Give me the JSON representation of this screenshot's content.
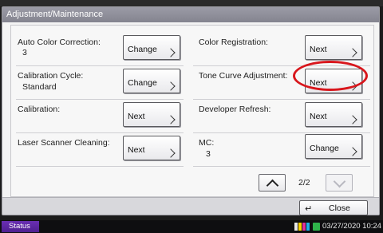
{
  "window": {
    "title": "Adjustment/Maintenance"
  },
  "items": {
    "auto_color_correction": {
      "label": "Auto Color Correction:",
      "value": "3",
      "button": "Change"
    },
    "color_registration": {
      "label": "Color Registration:",
      "button": "Next"
    },
    "calibration_cycle": {
      "label": "Calibration Cycle:",
      "value": "Standard",
      "button": "Change"
    },
    "tone_curve_adjustment": {
      "label": "Tone Curve Adjustment:",
      "button": "Next"
    },
    "calibration": {
      "label": "Calibration:",
      "button": "Next"
    },
    "developer_refresh": {
      "label": "Developer Refresh:",
      "button": "Next"
    },
    "laser_scanner_cleaning": {
      "label": "Laser Scanner Cleaning:",
      "button": "Next"
    },
    "mc": {
      "label": "MC:",
      "value": "3",
      "button": "Change"
    }
  },
  "pager": {
    "indicator": "2/2"
  },
  "footer": {
    "close_label": "Close"
  },
  "status_bar": {
    "status_label": "Status",
    "datetime": "03/27/2020 10:24"
  },
  "colors": {
    "title_bar": "#8e8e99",
    "status_button": "#5a25a0",
    "highlight": "#d8161c",
    "toner": [
      "#e8e8e8",
      "#ffd400",
      "#e0339a",
      "#1eb0e8"
    ]
  },
  "icons": {
    "chevron": "chevron-right-icon",
    "up": "chevron-up-icon",
    "down": "chevron-down-icon",
    "close": "enter-icon",
    "clock": "clock-icon"
  }
}
